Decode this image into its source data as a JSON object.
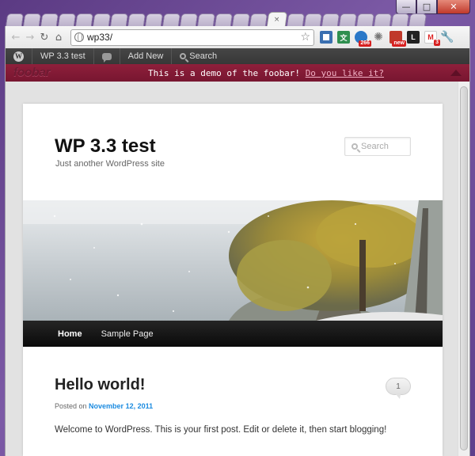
{
  "browser": {
    "active_tab_close": "×",
    "url": "wp33/",
    "window_controls": {
      "minimize": "—",
      "maximize": "□",
      "close": "✕"
    },
    "extensions": [
      {
        "name": "tiles-extension",
        "color": "#3a6fb0",
        "badge": ""
      },
      {
        "name": "translate-extension",
        "color": "#2f8f4f",
        "badge": ""
      },
      {
        "name": "reader-extension",
        "color": "#2a78c8",
        "badge": "266"
      },
      {
        "name": "gear-extension",
        "color": "#777777",
        "badge": ""
      },
      {
        "name": "news-extension",
        "color": "#c0392b",
        "badge": "new"
      },
      {
        "name": "lastpass-extension",
        "color": "#222222",
        "badge": ""
      },
      {
        "name": "gmail-extension",
        "color": "#ffffff",
        "badge": "3"
      }
    ]
  },
  "adminbar": {
    "site_name": "WP 3.3 test",
    "add_new": "Add New",
    "search": "Search"
  },
  "foobar": {
    "logo": "foobar",
    "message": "This is a demo of the foobar!",
    "link": "Do you like it?",
    "color": "#8f1f3b"
  },
  "site": {
    "title": "WP 3.3 test",
    "description": "Just another WordPress site",
    "search_placeholder": "Search",
    "nav": [
      "Home",
      "Sample Page"
    ]
  },
  "post": {
    "title": "Hello world!",
    "comments": "1",
    "posted_on": "Posted on",
    "date": "November 12, 2011",
    "body": "Welcome to WordPress. This is your first post. Edit or delete it, then start blogging!"
  }
}
